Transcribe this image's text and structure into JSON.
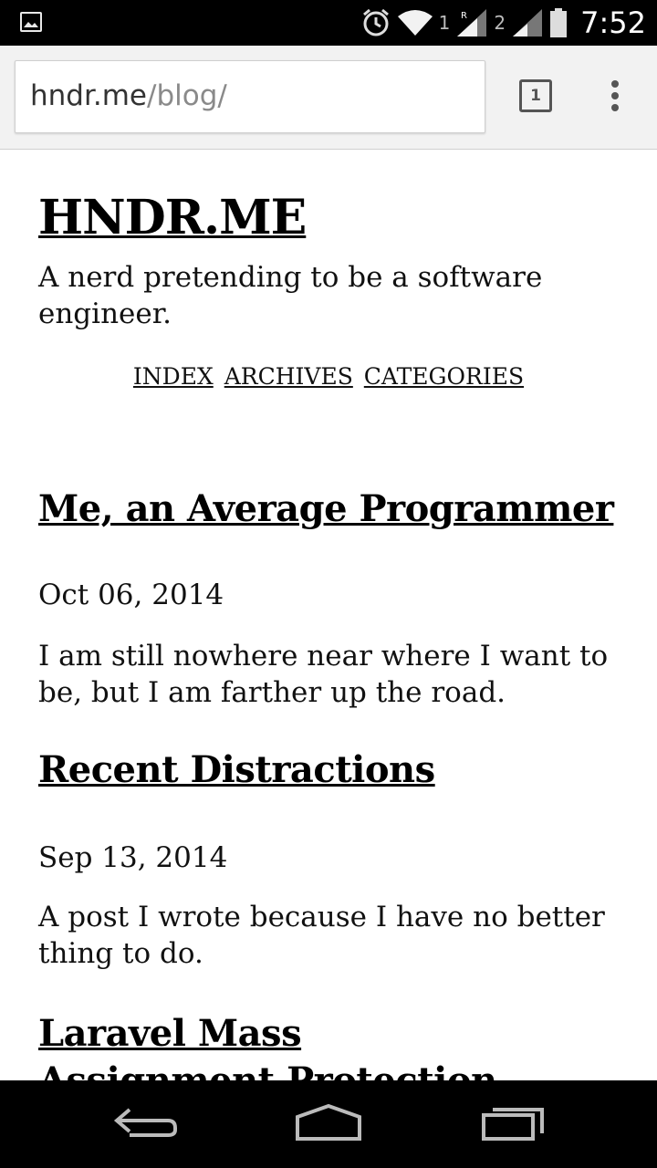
{
  "status_bar": {
    "time": "7:52",
    "sim1": "1",
    "sim2": "2",
    "icons": [
      "image-icon",
      "alarm-icon",
      "wifi-icon",
      "signal-icon",
      "battery-icon"
    ]
  },
  "browser": {
    "url_host": "hndr.me",
    "url_path": "/blog/",
    "tab_count": "1"
  },
  "site": {
    "title": "HNDR.ME",
    "tagline": "A nerd pretending to be a software engineer.",
    "nav": [
      "INDEX",
      "ARCHIVES",
      "CATEGORIES"
    ]
  },
  "posts": [
    {
      "title": "Me, an Average Programmer",
      "date": "Oct 06, 2014",
      "summary": "I am still nowhere near where I want to be, but I am farther up the road."
    },
    {
      "title": "Recent Distractions",
      "date": "Sep 13, 2014",
      "summary": "A post I wrote because I have no better thing to do."
    },
    {
      "title": "Laravel Mass Assignment Protection - Blacklist"
    }
  ]
}
